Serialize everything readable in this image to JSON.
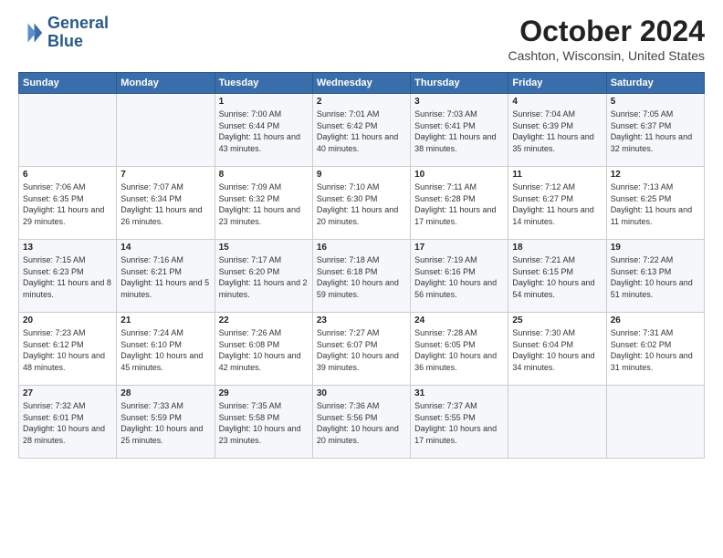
{
  "header": {
    "logo_line1": "General",
    "logo_line2": "Blue",
    "month_title": "October 2024",
    "location": "Cashton, Wisconsin, United States"
  },
  "weekdays": [
    "Sunday",
    "Monday",
    "Tuesday",
    "Wednesday",
    "Thursday",
    "Friday",
    "Saturday"
  ],
  "weeks": [
    [
      {
        "day": "",
        "info": ""
      },
      {
        "day": "",
        "info": ""
      },
      {
        "day": "1",
        "info": "Sunrise: 7:00 AM\nSunset: 6:44 PM\nDaylight: 11 hours and 43 minutes."
      },
      {
        "day": "2",
        "info": "Sunrise: 7:01 AM\nSunset: 6:42 PM\nDaylight: 11 hours and 40 minutes."
      },
      {
        "day": "3",
        "info": "Sunrise: 7:03 AM\nSunset: 6:41 PM\nDaylight: 11 hours and 38 minutes."
      },
      {
        "day": "4",
        "info": "Sunrise: 7:04 AM\nSunset: 6:39 PM\nDaylight: 11 hours and 35 minutes."
      },
      {
        "day": "5",
        "info": "Sunrise: 7:05 AM\nSunset: 6:37 PM\nDaylight: 11 hours and 32 minutes."
      }
    ],
    [
      {
        "day": "6",
        "info": "Sunrise: 7:06 AM\nSunset: 6:35 PM\nDaylight: 11 hours and 29 minutes."
      },
      {
        "day": "7",
        "info": "Sunrise: 7:07 AM\nSunset: 6:34 PM\nDaylight: 11 hours and 26 minutes."
      },
      {
        "day": "8",
        "info": "Sunrise: 7:09 AM\nSunset: 6:32 PM\nDaylight: 11 hours and 23 minutes."
      },
      {
        "day": "9",
        "info": "Sunrise: 7:10 AM\nSunset: 6:30 PM\nDaylight: 11 hours and 20 minutes."
      },
      {
        "day": "10",
        "info": "Sunrise: 7:11 AM\nSunset: 6:28 PM\nDaylight: 11 hours and 17 minutes."
      },
      {
        "day": "11",
        "info": "Sunrise: 7:12 AM\nSunset: 6:27 PM\nDaylight: 11 hours and 14 minutes."
      },
      {
        "day": "12",
        "info": "Sunrise: 7:13 AM\nSunset: 6:25 PM\nDaylight: 11 hours and 11 minutes."
      }
    ],
    [
      {
        "day": "13",
        "info": "Sunrise: 7:15 AM\nSunset: 6:23 PM\nDaylight: 11 hours and 8 minutes."
      },
      {
        "day": "14",
        "info": "Sunrise: 7:16 AM\nSunset: 6:21 PM\nDaylight: 11 hours and 5 minutes."
      },
      {
        "day": "15",
        "info": "Sunrise: 7:17 AM\nSunset: 6:20 PM\nDaylight: 11 hours and 2 minutes."
      },
      {
        "day": "16",
        "info": "Sunrise: 7:18 AM\nSunset: 6:18 PM\nDaylight: 10 hours and 59 minutes."
      },
      {
        "day": "17",
        "info": "Sunrise: 7:19 AM\nSunset: 6:16 PM\nDaylight: 10 hours and 56 minutes."
      },
      {
        "day": "18",
        "info": "Sunrise: 7:21 AM\nSunset: 6:15 PM\nDaylight: 10 hours and 54 minutes."
      },
      {
        "day": "19",
        "info": "Sunrise: 7:22 AM\nSunset: 6:13 PM\nDaylight: 10 hours and 51 minutes."
      }
    ],
    [
      {
        "day": "20",
        "info": "Sunrise: 7:23 AM\nSunset: 6:12 PM\nDaylight: 10 hours and 48 minutes."
      },
      {
        "day": "21",
        "info": "Sunrise: 7:24 AM\nSunset: 6:10 PM\nDaylight: 10 hours and 45 minutes."
      },
      {
        "day": "22",
        "info": "Sunrise: 7:26 AM\nSunset: 6:08 PM\nDaylight: 10 hours and 42 minutes."
      },
      {
        "day": "23",
        "info": "Sunrise: 7:27 AM\nSunset: 6:07 PM\nDaylight: 10 hours and 39 minutes."
      },
      {
        "day": "24",
        "info": "Sunrise: 7:28 AM\nSunset: 6:05 PM\nDaylight: 10 hours and 36 minutes."
      },
      {
        "day": "25",
        "info": "Sunrise: 7:30 AM\nSunset: 6:04 PM\nDaylight: 10 hours and 34 minutes."
      },
      {
        "day": "26",
        "info": "Sunrise: 7:31 AM\nSunset: 6:02 PM\nDaylight: 10 hours and 31 minutes."
      }
    ],
    [
      {
        "day": "27",
        "info": "Sunrise: 7:32 AM\nSunset: 6:01 PM\nDaylight: 10 hours and 28 minutes."
      },
      {
        "day": "28",
        "info": "Sunrise: 7:33 AM\nSunset: 5:59 PM\nDaylight: 10 hours and 25 minutes."
      },
      {
        "day": "29",
        "info": "Sunrise: 7:35 AM\nSunset: 5:58 PM\nDaylight: 10 hours and 23 minutes."
      },
      {
        "day": "30",
        "info": "Sunrise: 7:36 AM\nSunset: 5:56 PM\nDaylight: 10 hours and 20 minutes."
      },
      {
        "day": "31",
        "info": "Sunrise: 7:37 AM\nSunset: 5:55 PM\nDaylight: 10 hours and 17 minutes."
      },
      {
        "day": "",
        "info": ""
      },
      {
        "day": "",
        "info": ""
      }
    ]
  ]
}
